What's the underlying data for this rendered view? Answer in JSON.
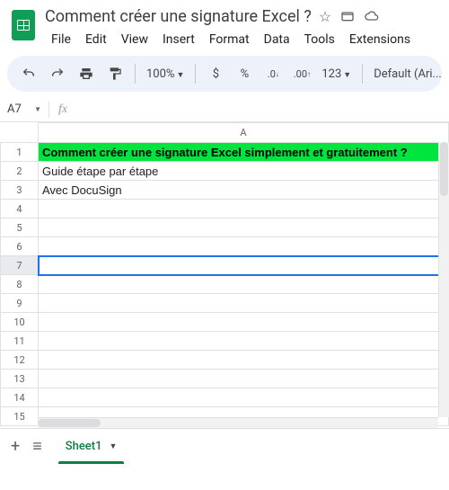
{
  "header": {
    "doc_title": "Comment créer une signature Excel ?",
    "menus": [
      "File",
      "Edit",
      "View",
      "Insert",
      "Format",
      "Data",
      "Tools",
      "Extensions"
    ]
  },
  "toolbar": {
    "zoom": "100%",
    "currency": "$",
    "percent": "%",
    "dec_dec": ".0",
    "inc_dec": ".00",
    "numfmt": "123",
    "font": "Default (Ari..."
  },
  "namebox": {
    "active_cell": "A7",
    "fx_label": "fx"
  },
  "grid": {
    "columns": [
      "A"
    ],
    "rows": [
      {
        "n": 1,
        "value": "Comment créer une signature Excel simplement et gratuitement ?",
        "highlight": true
      },
      {
        "n": 2,
        "value": "Guide étape par étape"
      },
      {
        "n": 3,
        "value": "Avec DocuSign"
      },
      {
        "n": 4,
        "value": ""
      },
      {
        "n": 5,
        "value": ""
      },
      {
        "n": 6,
        "value": ""
      },
      {
        "n": 7,
        "value": "",
        "selected": true
      },
      {
        "n": 8,
        "value": ""
      },
      {
        "n": 9,
        "value": ""
      },
      {
        "n": 10,
        "value": ""
      },
      {
        "n": 11,
        "value": ""
      },
      {
        "n": 12,
        "value": ""
      },
      {
        "n": 13,
        "value": ""
      },
      {
        "n": 14,
        "value": ""
      },
      {
        "n": 15,
        "value": ""
      }
    ]
  },
  "sheets": {
    "active": "Sheet1"
  },
  "colors": {
    "highlight": "#00e53d",
    "selection": "#1a73e8",
    "brand_green": "#0f9d58"
  }
}
